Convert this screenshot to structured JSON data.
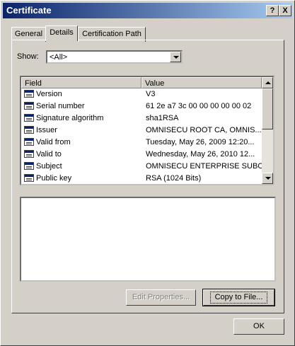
{
  "window": {
    "title": "Certificate",
    "help_glyph": "?",
    "close_glyph": "X"
  },
  "tabs": [
    {
      "label": "General"
    },
    {
      "label": "Details"
    },
    {
      "label": "Certification Path"
    }
  ],
  "show": {
    "label": "Show:",
    "selected": "<All>"
  },
  "list": {
    "columns": [
      "Field",
      "Value"
    ],
    "rows": [
      {
        "field": "Version",
        "value": "V3"
      },
      {
        "field": "Serial number",
        "value": "61 2e a7 3c 00 00 00 00 00 02"
      },
      {
        "field": "Signature algorithm",
        "value": "sha1RSA"
      },
      {
        "field": "Issuer",
        "value": "OMNISECU ROOT CA, OMNIS..."
      },
      {
        "field": "Valid from",
        "value": "Tuesday, May 26, 2009 12:20..."
      },
      {
        "field": "Valid to",
        "value": "Wednesday, May 26, 2010 12..."
      },
      {
        "field": "Subject",
        "value": "OMNISECU ENTERPRISE SUBO..."
      },
      {
        "field": "Public key",
        "value": "RSA (1024 Bits)"
      }
    ]
  },
  "buttons": {
    "edit_properties": "Edit Properties...",
    "copy_to_file": "Copy to File...",
    "ok": "OK"
  },
  "colors": {
    "title_bar_start": "#0a246a",
    "title_bar_end": "#a6caf0",
    "dialog_face": "#d4d0c8"
  }
}
